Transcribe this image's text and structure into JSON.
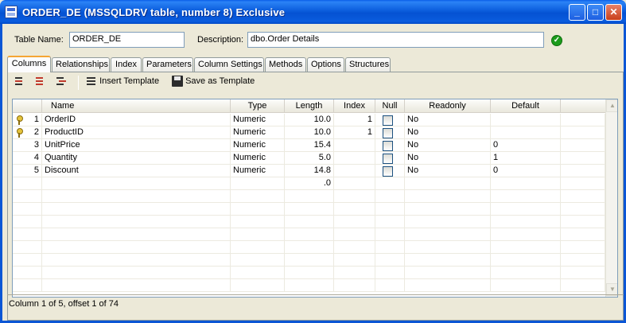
{
  "window": {
    "title": "ORDER_DE  (MSSQLDRV table, number 8)  Exclusive",
    "minimize_glyph": "_",
    "maximize_glyph": "□",
    "close_glyph": "✕"
  },
  "form": {
    "table_name_label": "Table Name:",
    "table_name_value": "ORDER_DE",
    "description_label": "Description:",
    "description_value": "dbo.Order Details",
    "ok_glyph": "✓"
  },
  "tabs": [
    "Columns",
    "Relationships",
    "Index",
    "Parameters",
    "Column Settings",
    "Methods",
    "Options",
    "Structures"
  ],
  "active_tab": "Columns",
  "toolbar": {
    "insert_template_label": "Insert Template",
    "save_template_label": "Save as Template"
  },
  "grid": {
    "columns": [
      "Name",
      "Type",
      "Length",
      "Index",
      "Null",
      "Readonly",
      "Default"
    ],
    "rows": [
      {
        "key": true,
        "num": "1",
        "name": "OrderID",
        "type": "Numeric",
        "length": "10.0",
        "index": "1",
        "readonly": "No",
        "default": ""
      },
      {
        "key": true,
        "num": "2",
        "name": "ProductID",
        "type": "Numeric",
        "length": "10.0",
        "index": "1",
        "readonly": "No",
        "default": ""
      },
      {
        "key": false,
        "num": "3",
        "name": "UnitPrice",
        "type": "Numeric",
        "length": "15.4",
        "index": "",
        "readonly": "No",
        "default": "0"
      },
      {
        "key": false,
        "num": "4",
        "name": "Quantity",
        "type": "Numeric",
        "length": "5.0",
        "index": "",
        "readonly": "No",
        "default": "1"
      },
      {
        "key": false,
        "num": "5",
        "name": "Discount",
        "type": "Numeric",
        "length": "14.8",
        "index": "",
        "readonly": "No",
        "default": "0"
      }
    ],
    "new_row_length": ".0"
  },
  "scrollbar": {
    "up_glyph": "▲",
    "down_glyph": "▼"
  },
  "status_text": "Column 1 of 5, offset 1 of 74"
}
